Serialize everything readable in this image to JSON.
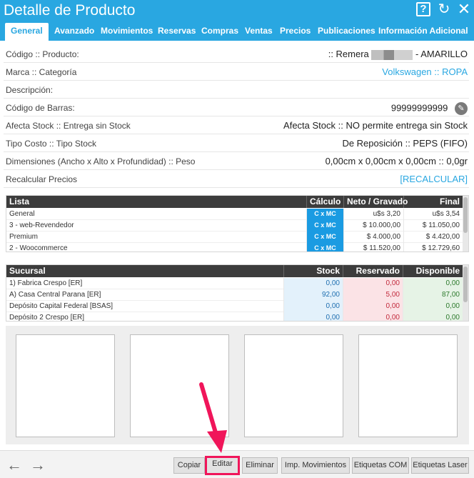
{
  "window": {
    "title": "Detalle de Producto",
    "help_glyph": "?",
    "refresh_glyph": "↻",
    "close_glyph": "✕"
  },
  "tabs": [
    "General",
    "Avanzado",
    "Movimientos",
    "Reservas",
    "Compras",
    "Ventas",
    "Precios",
    "Publicaciones",
    "Información Adicional"
  ],
  "fields": {
    "codigo": {
      "label": "Código :: Producto:",
      "value_prefix": ":: Remera",
      "value_suffix": "- AMARILLO"
    },
    "marca": {
      "label": "Marca :: Categoría",
      "value": "Volkswagen :: ROPA"
    },
    "descripcion": {
      "label": "Descripción:",
      "value": ""
    },
    "barras": {
      "label": "Código de Barras:",
      "value": "99999999999"
    },
    "stock": {
      "label": "Afecta Stock :: Entrega sin Stock",
      "value": "Afecta Stock :: NO permite entrega sin Stock"
    },
    "costo": {
      "label": "Tipo Costo :: Tipo Stock",
      "value": "De Reposición :: PEPS (FIFO)"
    },
    "dimensiones": {
      "label": "Dimensiones (Ancho x Alto x Profundidad) :: Peso",
      "value": "0,00cm x 0,00cm x 0,00cm :: 0,0gr"
    },
    "recalcular": {
      "label": "Recalcular Precios",
      "value": "[RECALCULAR]"
    }
  },
  "price_table": {
    "headers": [
      "Lista",
      "Cálculo",
      "Neto / Gravado",
      "Final"
    ],
    "rows": [
      [
        "General",
        "C x MC",
        "u$s 3,20",
        "u$s 3,54"
      ],
      [
        "3 - web-Revendedor",
        "C x MC",
        "$ 10.000,00",
        "$ 11.050,00"
      ],
      [
        "Premium",
        "C x MC",
        "$ 4.000,00",
        "$ 4.420,00"
      ],
      [
        "2 - Woocommerce",
        "C x MC",
        "$ 11.520,00",
        "$ 12.729,60"
      ]
    ]
  },
  "stock_table": {
    "headers": [
      "Sucursal",
      "Stock",
      "Reservado",
      "Disponible"
    ],
    "rows": [
      [
        "1) Fabrica Crespo [ER]",
        "0,00",
        "0,00",
        "0,00"
      ],
      [
        "A) Casa Central Parana [ER]",
        "92,00",
        "5,00",
        "87,00"
      ],
      [
        "Depósito Capital Federal [BSAS]",
        "0,00",
        "0,00",
        "0,00"
      ],
      [
        "Depósito 2 Crespo [ER]",
        "0,00",
        "0,00",
        "0,00"
      ]
    ]
  },
  "footer": {
    "back_glyph": "←",
    "forward_glyph": "→",
    "buttons": {
      "copiar": "Copiar",
      "editar": "Editar",
      "eliminar": "Eliminar",
      "imp_movimientos": "Imp. Movimientos",
      "etiquetas_com": "Etiquetas COM",
      "etiquetas_laser": "Etiquetas Laser"
    }
  },
  "colors": {
    "accent": "#29a7e1",
    "highlight": "#f0155a",
    "badge": "#1a9be2"
  }
}
